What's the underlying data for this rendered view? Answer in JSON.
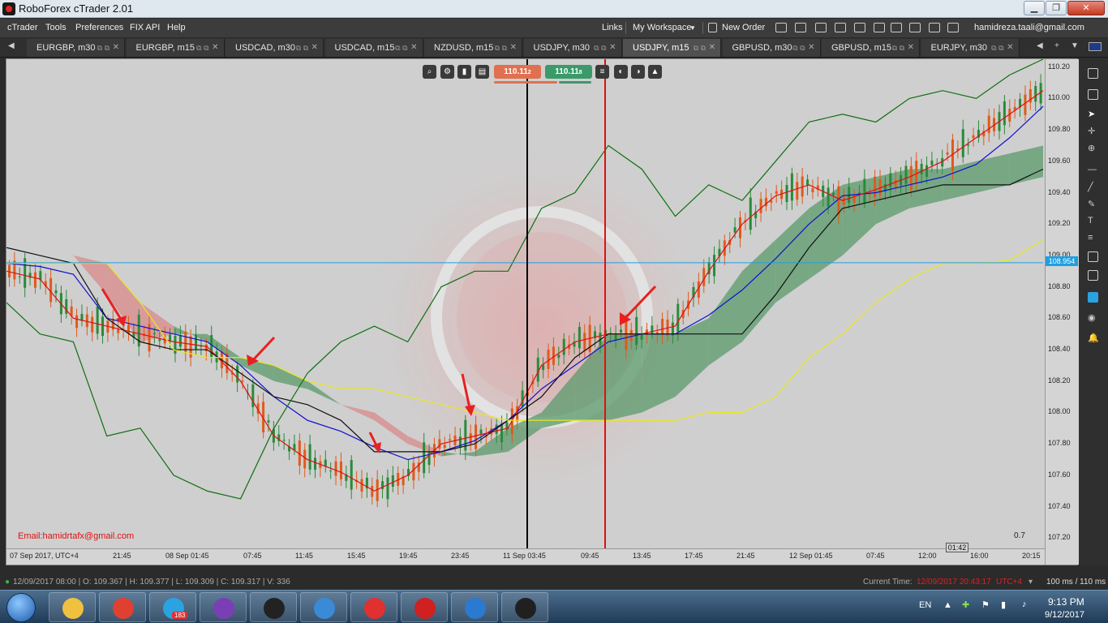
{
  "window": {
    "title": "RoboForex cTrader 2.01",
    "min_label": "▁",
    "max_label": "❐",
    "close_label": "✕"
  },
  "menu": {
    "items": [
      "cTrader",
      "Tools",
      "Preferences",
      "FIX API",
      "Help"
    ],
    "links": "Links",
    "workspace": "My Workspace",
    "new_order": "New Order",
    "user": "hamidreza.taali@gmail.com"
  },
  "tabs": [
    {
      "label": "EURGBP, m30"
    },
    {
      "label": "EURGBP, m15"
    },
    {
      "label": "USDCAD, m30"
    },
    {
      "label": "USDCAD, m15"
    },
    {
      "label": "NZDUSD, m15"
    },
    {
      "label": "USDJPY, m30"
    },
    {
      "label": "USDJPY, m15"
    },
    {
      "label": "GBPUSD, m30"
    },
    {
      "label": "GBPUSD, m15"
    },
    {
      "label": "EURJPY, m30"
    }
  ],
  "active_tab": 6,
  "chart": {
    "sell_price": "110.11",
    "sell_suffix": "2",
    "buy_price": "110.11",
    "buy_suffix": "8",
    "email": "Email:hamidrtafx@gmail.com",
    "scale_value": "0.7",
    "current_price": "108.954",
    "time_tag": "01:42"
  },
  "chart_data": {
    "type": "line",
    "title": "",
    "y_ticks": [
      "110.20",
      "110.00",
      "109.80",
      "109.60",
      "109.40",
      "109.20",
      "109.00",
      "108.80",
      "108.60",
      "108.40",
      "108.20",
      "108.00",
      "107.80",
      "107.60",
      "107.40",
      "107.20"
    ],
    "ylim": [
      107.15,
      110.25
    ],
    "x_ticks": [
      "07 Sep 2017, UTC+4",
      "21:45",
      "08 Sep 01:45",
      "07:45",
      "11:45",
      "15:45",
      "19:45",
      "23:45",
      "11 Sep 03:45",
      "09:45",
      "13:45",
      "17:45",
      "21:45",
      "12 Sep 01:45",
      "07:45",
      "12:00",
      "16:00",
      "20:15"
    ],
    "horizontal_line": 108.954,
    "series": [
      {
        "color": "#1010d0",
        "values": [
          108.95,
          108.93,
          108.88,
          108.6,
          108.55,
          108.5,
          108.45,
          108.3,
          108.1,
          107.95,
          107.88,
          107.78,
          107.7,
          107.75,
          107.82,
          107.95,
          108.15,
          108.3,
          108.45,
          108.5,
          108.5,
          108.62,
          108.78,
          108.98,
          109.2,
          109.38,
          109.4,
          109.45,
          109.5,
          109.58,
          109.75,
          109.95
        ]
      },
      {
        "color": "#e01010",
        "values": [
          108.9,
          108.85,
          108.6,
          108.55,
          108.5,
          108.45,
          108.42,
          108.2,
          107.85,
          107.7,
          107.62,
          107.5,
          107.6,
          107.8,
          107.85,
          107.9,
          108.3,
          108.45,
          108.5,
          108.5,
          108.55,
          108.9,
          109.2,
          109.38,
          109.45,
          109.35,
          109.42,
          109.5,
          109.6,
          109.75,
          109.9,
          110.05
        ]
      },
      {
        "color": "#101010",
        "values": [
          109.05,
          109.0,
          108.95,
          108.6,
          108.45,
          108.4,
          108.4,
          108.25,
          108.1,
          108.05,
          107.95,
          107.75,
          107.75,
          107.75,
          107.8,
          107.95,
          108.1,
          108.35,
          108.5,
          108.5,
          108.5,
          108.5,
          108.5,
          108.75,
          109.05,
          109.3,
          109.35,
          109.4,
          109.45,
          109.45,
          109.45,
          109.55
        ]
      },
      {
        "color": "#e8e820",
        "values": [
          108.95,
          108.95,
          108.95,
          108.95,
          108.7,
          108.4,
          108.35,
          108.35,
          108.3,
          108.2,
          108.15,
          108.15,
          108.1,
          108.05,
          108.0,
          107.95,
          107.95,
          107.95,
          107.95,
          107.95,
          107.95,
          108.0,
          108.0,
          108.1,
          108.35,
          108.5,
          108.7,
          108.85,
          108.95,
          108.95,
          108.97,
          109.1
        ]
      },
      {
        "color": "#107010",
        "values": [
          108.7,
          108.5,
          108.45,
          107.85,
          107.9,
          107.6,
          107.5,
          107.45,
          107.9,
          108.25,
          108.45,
          108.55,
          108.45,
          108.8,
          108.9,
          108.9,
          109.3,
          109.4,
          109.7,
          109.55,
          109.25,
          109.45,
          109.35,
          109.6,
          109.85,
          109.9,
          109.85,
          110.0,
          110.05,
          110.0,
          110.15,
          110.25
        ]
      }
    ],
    "cloud": {
      "span_a": [
        109.05,
        109.05,
        109.0,
        108.75,
        108.45,
        108.5,
        108.5,
        108.35,
        108.3,
        108.2,
        108.05,
        107.95,
        107.8,
        107.72,
        107.75,
        107.9,
        108.0,
        108.25,
        108.5,
        108.5,
        108.5,
        108.6,
        108.9,
        109.1,
        109.3,
        109.45,
        109.5,
        109.55,
        109.55,
        109.6,
        109.65,
        109.7
      ],
      "span_b": [
        109.05,
        109.05,
        109.0,
        108.95,
        108.7,
        108.55,
        108.45,
        108.3,
        108.2,
        108.15,
        108.05,
        108.0,
        107.85,
        107.75,
        107.72,
        107.75,
        107.9,
        107.95,
        107.95,
        108.0,
        108.1,
        108.3,
        108.45,
        108.7,
        108.85,
        109.0,
        109.2,
        109.3,
        109.35,
        109.4,
        109.45,
        109.5
      ],
      "bull_color": "#5b9a6b",
      "bear_color": "#d98a8a"
    },
    "vertical_lines": [
      {
        "color": "#000000",
        "x_label": "11 Sep 03:45"
      },
      {
        "color": "#e01010",
        "x_label": "09:45"
      }
    ],
    "grid": false
  },
  "statusbar": {
    "ohlc": "12/09/2017 08:00 | O: 109.367 | H: 109.377 | L: 109.309 | C: 109.317 | V: 336",
    "current_time_label": "Current Time:",
    "current_time": "12/09/2017 20:43:17",
    "tz": "UTC+4",
    "latency": "100 ms / 110 ms"
  },
  "taskbar": {
    "lang": "EN",
    "time": "9:13 PM",
    "date": "9/12/2017",
    "badge": "183",
    "apps": [
      {
        "icon": "folder-icon",
        "color": "#f0c040"
      },
      {
        "icon": "chrome-icon",
        "color": "#e04030"
      },
      {
        "icon": "telegram-icon",
        "color": "#2aa3e0"
      },
      {
        "icon": "visual-studio-icon",
        "color": "#7a3fb5"
      },
      {
        "icon": "roboforex-icon",
        "color": "#222222"
      },
      {
        "icon": "window-icon",
        "color": "#3a8ad8"
      },
      {
        "icon": "ctrader-icon",
        "color": "#e03030"
      },
      {
        "icon": "ctrader-g-icon",
        "color": "#d02020"
      },
      {
        "icon": "edge-icon",
        "color": "#2a7ad0"
      },
      {
        "icon": "circle-app-icon",
        "color": "#202020"
      }
    ]
  }
}
